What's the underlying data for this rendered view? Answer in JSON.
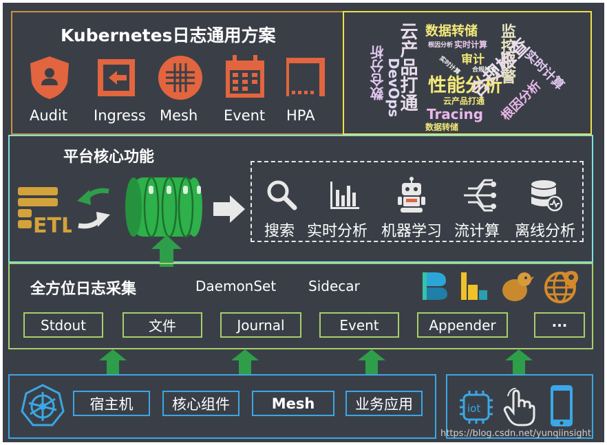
{
  "top_left": {
    "title": "Kubernetes日志通用方案",
    "items": [
      {
        "label": "Audit",
        "icon": "shield-user-icon"
      },
      {
        "label": "Ingress",
        "icon": "enter-icon"
      },
      {
        "label": "Mesh",
        "icon": "mesh-grid-icon"
      },
      {
        "label": "Event",
        "icon": "calendar-icon"
      },
      {
        "label": "HPA",
        "icon": "scale-frame-icon"
      }
    ]
  },
  "word_cloud": {
    "words": [
      "数据转储",
      "监控报警",
      "实时计算",
      "根因分析",
      "审计",
      "实时计算",
      "云产品打通",
      "性能分析",
      "合规检查",
      "DevOps",
      "数仓分析",
      "Tracing",
      "云产品打通",
      "根因分析",
      "数据转储",
      "合规检查",
      "实时计算"
    ]
  },
  "platform": {
    "title": "平台核心功能",
    "functions": [
      {
        "label": "搜索",
        "icon": "search-icon"
      },
      {
        "label": "实时分析",
        "icon": "bar-chart-icon"
      },
      {
        "label": "机器学习",
        "icon": "robot-icon"
      },
      {
        "label": "流计算",
        "icon": "stream-icon"
      },
      {
        "label": "离线分析",
        "icon": "database-icon"
      }
    ],
    "etl_icon": "etl-icon",
    "storage_icon": "storage-disk-icon"
  },
  "collection": {
    "title": "全方位日志采集",
    "modes": [
      "DaemonSet",
      "Sidecar"
    ],
    "sources": [
      "Stdout",
      "文件",
      "Journal",
      "Event",
      "Appender",
      "···"
    ]
  },
  "bottom_left": {
    "items": [
      "宿主机",
      "核心组件",
      "Mesh",
      "业务应用"
    ],
    "icon": "kubernetes-helm-icon"
  },
  "bottom_right": {
    "icons": [
      "iot-chip-icon",
      "touch-hand-icon",
      "mobile-phone-icon"
    ]
  },
  "watermark": "https://blog.csdn.net/yunqiinsight",
  "colors": {
    "background": "#3a3f47",
    "orange": "#e2653f",
    "gold_border": "#d4a23a",
    "yellow_border": "#f0e04a",
    "cyan_border": "#7fe0e0",
    "green_border": "#a6d06a",
    "blue_border": "#3ba7e6",
    "green_arrow": "#2e9e4a"
  }
}
